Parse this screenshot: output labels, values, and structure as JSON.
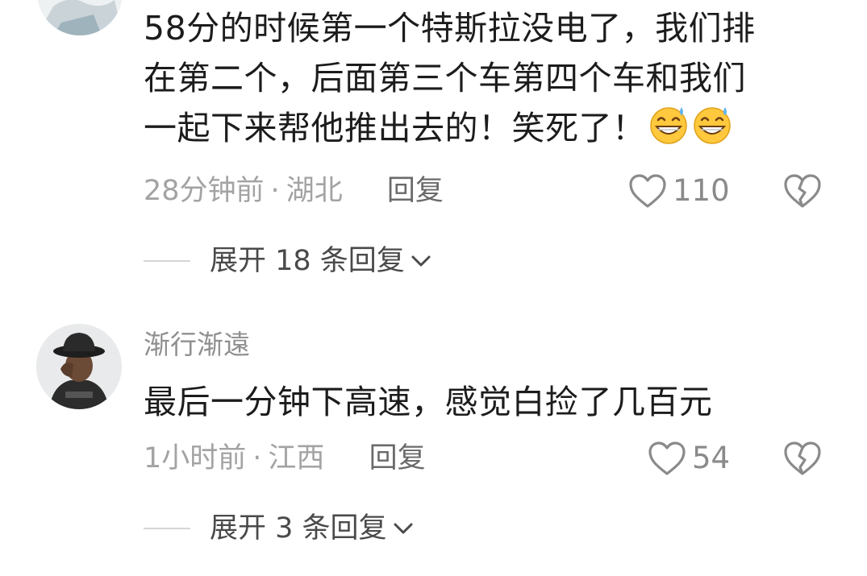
{
  "comments": [
    {
      "lines": [
        "58分的时候第一个特斯拉没电了，我们排",
        "在第二个，后面第三个车第四个车和我们",
        "一起下来帮他推出去的！笑死了！"
      ],
      "emoji": [
        "grin-sweat-emoji",
        "grin-sweat-emoji"
      ],
      "time": "28分钟前",
      "separator": "·",
      "location": "湖北",
      "reply_label": "回复",
      "likes": "110",
      "expand_label": "展开 18 条回复"
    },
    {
      "username": "渐行渐遠",
      "lines": [
        "最后一分钟下高速，感觉白捡了几百元"
      ],
      "time": "1小时前",
      "separator": "·",
      "location": "江西",
      "reply_label": "回复",
      "likes": "54",
      "expand_label": "展开 3 条回复"
    }
  ],
  "colors": {
    "text": "#1c1c1c",
    "muted": "#a3a3a3",
    "username": "#8f8f8f",
    "icon": "#8a8a8a"
  }
}
